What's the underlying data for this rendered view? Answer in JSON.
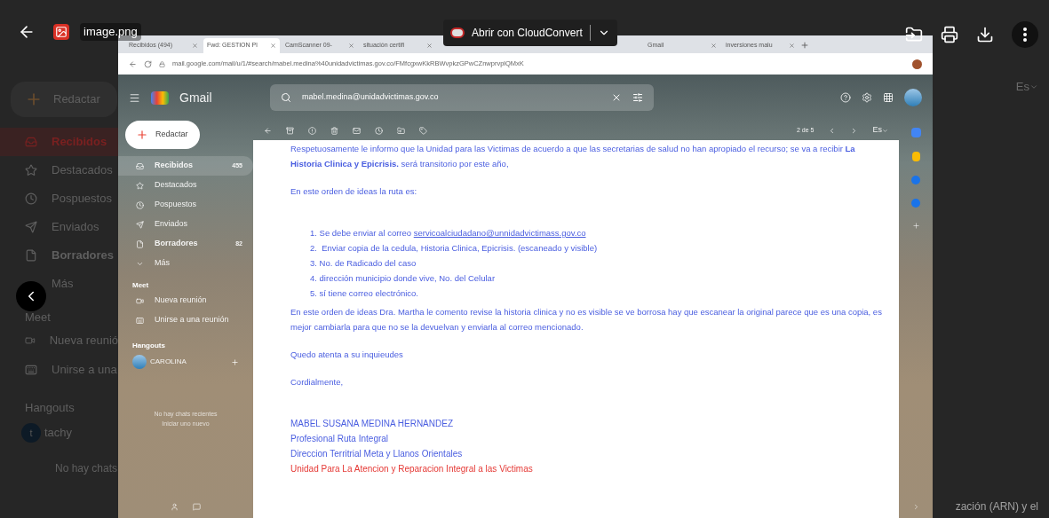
{
  "background_page": {
    "compose": "Redactar",
    "nav": [
      {
        "label": "Recibidos",
        "selected": true,
        "bold": false
      },
      {
        "label": "Destacados",
        "selected": false,
        "bold": false
      },
      {
        "label": "Pospuestos",
        "selected": false,
        "bold": false
      },
      {
        "label": "Enviados",
        "selected": false,
        "bold": false
      },
      {
        "label": "Borradores",
        "selected": false,
        "bold": true
      },
      {
        "label": "Más",
        "selected": false,
        "bold": false
      }
    ],
    "meet_heading": "Meet",
    "meet_items": [
      "Nueva reunió",
      "Unirse a una"
    ],
    "hangouts_heading": "Hangouts",
    "contact_initial": "t",
    "contact_name": "tachy",
    "no_chats": "No hay chats",
    "language": "Es",
    "snippet": "zación (ARN) y el"
  },
  "viewer": {
    "file_name": "image.png",
    "open_with": "Abrir con CloudConvert"
  },
  "screenshot": {
    "browser_tabs": [
      {
        "title": "Recibidos (494)",
        "selected": false
      },
      {
        "title": "Fwd: GESTION Pl",
        "selected": true
      },
      {
        "title": "CamScanner 09-",
        "selected": false
      },
      {
        "title": "situación certifi",
        "selected": false
      },
      {
        "title": "Gmail",
        "selected": false
      },
      {
        "title": "inversiones malu",
        "selected": false
      }
    ],
    "url": "mail.google.com/mail/u/1/#search/mabel.medina%40unidadvictimas.gov.co/FMfcgxwKkRBWvpkzGPwCZnwprvplQMxK",
    "app_name": "Gmail",
    "search_value": "mabel.medina@unidadvictimas.gov.co",
    "compose": "Redactar",
    "nav": [
      {
        "label": "Recibidos",
        "count": "455",
        "selected": true,
        "bold": true
      },
      {
        "label": "Destacados",
        "selected": false,
        "bold": false
      },
      {
        "label": "Pospuestos",
        "selected": false,
        "bold": false
      },
      {
        "label": "Enviados",
        "selected": false,
        "bold": false
      },
      {
        "label": "Borradores",
        "count": "82",
        "selected": false,
        "bold": true
      },
      {
        "label": "Más",
        "selected": false,
        "bold": false
      }
    ],
    "meet_heading": "Meet",
    "meet_items": [
      "Nueva reunión",
      "Unirse a una reunión"
    ],
    "hangouts_heading": "Hangouts",
    "contact_name": "CAROLINA",
    "no_chats": [
      "No hay chats recientes",
      "Iniciar uno nuevo"
    ],
    "pager": "2 de 5",
    "language": "Es",
    "email": {
      "intro": "Respetuosamente le informo que la Unidad para las Victimas de acuerdo a que las secretarias de salud no han apropiado el recurso; se va a recibir **La Historia Clinica y Epicrisis.** será transitorio por este año,",
      "route_intro": "En este orden de ideas la ruta es:",
      "steps": [
        {
          "number": "1.",
          "text": "Se debe enviar al correo ",
          "link": "servicoalciudadano@unnidadvictimass.gov.co"
        },
        {
          "number": "2.",
          "text": " Enviar copia de la cedula, Historia Clinica, Epicrisis. (escaneado y visible)"
        },
        {
          "number": "3.",
          "text": "No. de Radicado del caso"
        },
        {
          "number": "4.",
          "text": "dirección municipio donde vive, No. del Celular"
        },
        {
          "number": "5.",
          "text": "sí tiene correo electrónico."
        }
      ],
      "paragraph": "En este orden de ideas Dra. Martha le comento revise la historia clinica y no es visible se ve borrosa hay que escanear la original parece que es una copia, es mejor cambiarla para que no se la devuelvan y enviarla al correo mencionado.",
      "closing": "Quedo atenta a su inquieudes",
      "salutation": "Cordialmente,",
      "signature": [
        {
          "text": "MABEL SUSANA MEDINA HERNANDEZ",
          "color": "#4a5ee0"
        },
        {
          "text": "Profesional Ruta Integral",
          "color": "#4a5ee0"
        },
        {
          "text": "Direccion Territrial Meta y Llanos Orientales",
          "color": "#4a5ee0"
        },
        {
          "text": "Unidad Para La Atencion y Reparacion Integral a las Victimas",
          "color": "#e53935"
        }
      ]
    }
  }
}
